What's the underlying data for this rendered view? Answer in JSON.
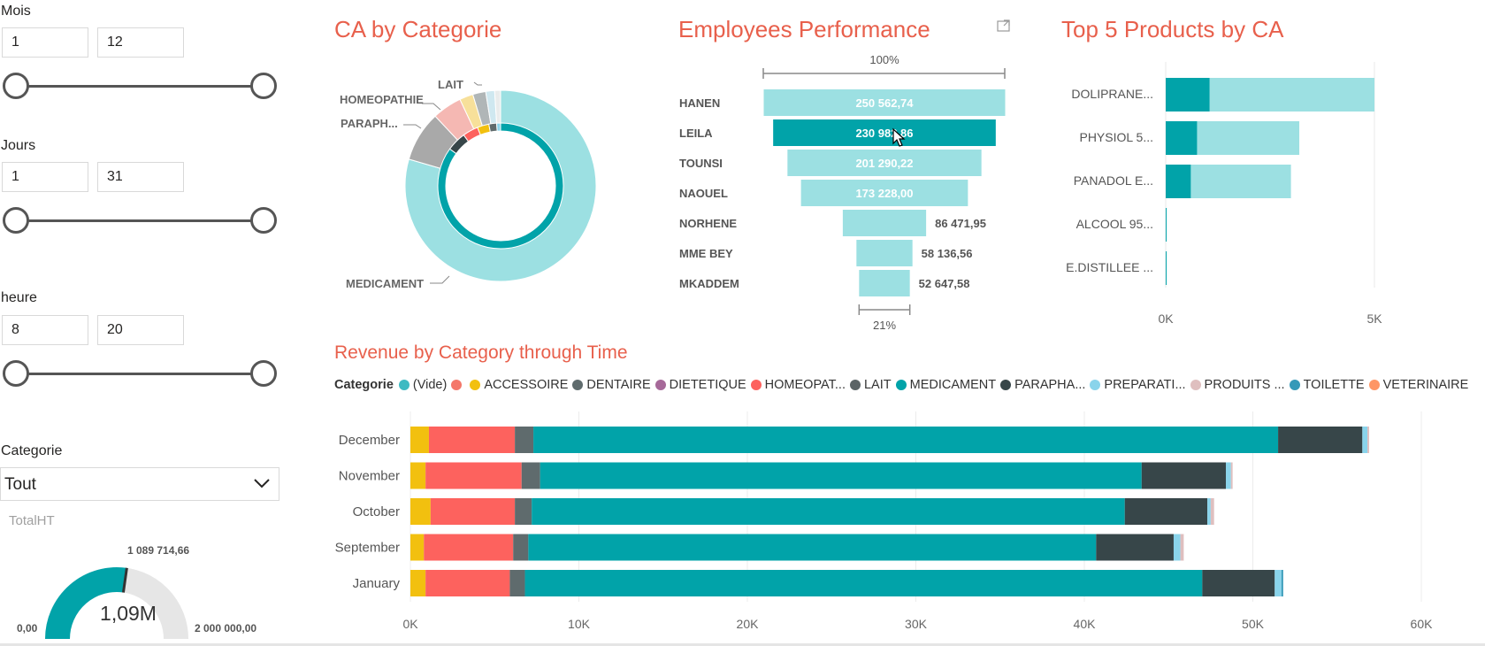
{
  "slicers": {
    "mois": {
      "title": "Mois",
      "min": "1",
      "max": "12"
    },
    "jours": {
      "title": "Jours",
      "min": "1",
      "max": "31"
    },
    "heure": {
      "title": "heure",
      "min": "8",
      "max": "20"
    },
    "categorie": {
      "title": "Categorie",
      "value": "Tout"
    }
  },
  "gauge": {
    "title": "TotalHT",
    "value_label": "1,09M",
    "target_label": "1 089 714,66",
    "min_label": "0,00",
    "max_label": "2 000 000,00",
    "value": 1089714.66,
    "min": 0,
    "max": 2000000,
    "colors": {
      "fill": "#01a3a9",
      "track": "#e6e6e6",
      "target": "#333333"
    }
  },
  "donut": {
    "title": "CA by Categorie",
    "labels": {
      "lait": "LAIT",
      "homeopathie": "HOMEOPATHIE",
      "parapha": "PARAPH...",
      "medicament": "MEDICAMENT"
    }
  },
  "funnel": {
    "title": "Employees Performance",
    "top_pct": "100%",
    "bottom_pct": "21%"
  },
  "top5": {
    "title": "Top 5 Products by CA",
    "axis": [
      "0K",
      "5K"
    ]
  },
  "revenue": {
    "title": "Revenue by Category through Time",
    "legend_title": "Categorie",
    "legend": [
      {
        "label": "(Vide)",
        "color": "#3fbac2"
      },
      {
        "label": "",
        "color": "#f4786a"
      },
      {
        "label": "ACCESSOIRE",
        "color": "#f2c00f"
      },
      {
        "label": "DENTAIRE",
        "color": "#5f6b6d"
      },
      {
        "label": "DIETETIQUE",
        "color": "#a66999"
      },
      {
        "label": "HOMEOPAT...",
        "color": "#fd625e"
      },
      {
        "label": "LAIT",
        "color": "#5b6466"
      },
      {
        "label": "MEDICAMENT",
        "color": "#01a3a9"
      },
      {
        "label": "PARAPHA...",
        "color": "#374649"
      },
      {
        "label": "PREPARATI...",
        "color": "#8ad4eb"
      },
      {
        "label": "PRODUITS ...",
        "color": "#dfbfbf"
      },
      {
        "label": "TOILETTE",
        "color": "#3599b8"
      },
      {
        "label": "VETERINAIRE",
        "color": "#fe9666"
      }
    ]
  },
  "chart_data": [
    {
      "type": "pie",
      "title": "CA by Categorie",
      "outer_ring": {
        "categories": [
          "MEDICAMENT",
          "PARAPH...",
          "HOMEOPATHIE",
          "LAIT",
          "",
          "",
          ""
        ],
        "values": [
          79.5,
          8.5,
          5.0,
          2.3,
          2.2,
          1.5,
          1.0
        ],
        "colors": [
          "#9ce0e2",
          "#a9a9a9",
          "#f5b8b3",
          "#f7e09a",
          "#b0b6b7",
          "#cfe8f0",
          "#e9ecec"
        ]
      },
      "inner_ring": {
        "values": [
          85,
          5,
          4,
          3,
          2,
          1
        ],
        "colors": [
          "#01a3a9",
          "#374649",
          "#fd625e",
          "#f2c00f",
          "#5f6b6d",
          "#8ad4eb"
        ]
      }
    },
    {
      "type": "bar",
      "subtype": "funnel",
      "title": "Employees Performance",
      "categories": [
        "HANEN",
        "LEILA",
        "TOUNSI",
        "NAOUEL",
        "NORHENE",
        "MME BEY",
        "MKADDEM"
      ],
      "values": [
        250562.74,
        230982.86,
        201290.22,
        173228.0,
        86471.95,
        58136.56,
        52647.58
      ],
      "value_labels": [
        "250 562,74",
        "230 982,86",
        "201 290,22",
        "173 228,00",
        "86 471,95",
        "58 136,56",
        "52 647,58"
      ],
      "highlighted": "LEILA",
      "colors": {
        "bar": "#9ce0e2",
        "highlight": "#01a3a9"
      }
    },
    {
      "type": "bar",
      "orientation": "horizontal",
      "title": "Top 5 Products by CA",
      "categories": [
        "DOLIPRANE...",
        "PHYSIOL 5...",
        "PANADOL E...",
        "ALCOOL 95...",
        "E.DISTILLEE ..."
      ],
      "series": [
        {
          "values": [
            1050,
            750,
            600,
            20,
            20
          ],
          "color": "#01a3a9"
        },
        {
          "values": [
            5000,
            3200,
            3000,
            20,
            20
          ],
          "color": "#9ce0e2"
        }
      ],
      "xlim": [
        0,
        5000
      ],
      "ticks": [
        "0K",
        "5K"
      ],
      "grid": true
    },
    {
      "type": "bar",
      "orientation": "horizontal",
      "stacked": true,
      "title": "Revenue by Category through Time",
      "categories": [
        "December",
        "November",
        "October",
        "September",
        "January"
      ],
      "xlim": [
        0,
        60000
      ],
      "ticks": [
        "0K",
        "10K",
        "20K",
        "30K",
        "40K",
        "50K",
        "60K"
      ],
      "grid": true,
      "legend_position": "top",
      "series": [
        {
          "name": "ACCESSOIRE",
          "color": "#f2c00f",
          "values": [
            1100,
            900,
            1200,
            800,
            900
          ]
        },
        {
          "name": "HOMEOPAT...",
          "color": "#fd625e",
          "values": [
            5100,
            5700,
            5000,
            5300,
            5000
          ]
        },
        {
          "name": "DENTAIRE",
          "color": "#5f6b6d",
          "values": [
            1100,
            1100,
            1000,
            900,
            900
          ]
        },
        {
          "name": "MEDICAMENT",
          "color": "#01a3a9",
          "values": [
            44200,
            35700,
            35200,
            33700,
            40200
          ]
        },
        {
          "name": "PARAPHA...",
          "color": "#374649",
          "values": [
            5000,
            5000,
            4900,
            4600,
            4300
          ]
        },
        {
          "name": "PREPARATI...",
          "color": "#8ad4eb",
          "values": [
            300,
            300,
            200,
            400,
            400
          ]
        },
        {
          "name": "PRODUITS ...",
          "color": "#dfbfbf",
          "values": [
            100,
            100,
            200,
            200,
            0
          ]
        },
        {
          "name": "TOILETTE",
          "color": "#3599b8",
          "values": [
            0,
            0,
            0,
            0,
            100
          ]
        }
      ]
    }
  ]
}
